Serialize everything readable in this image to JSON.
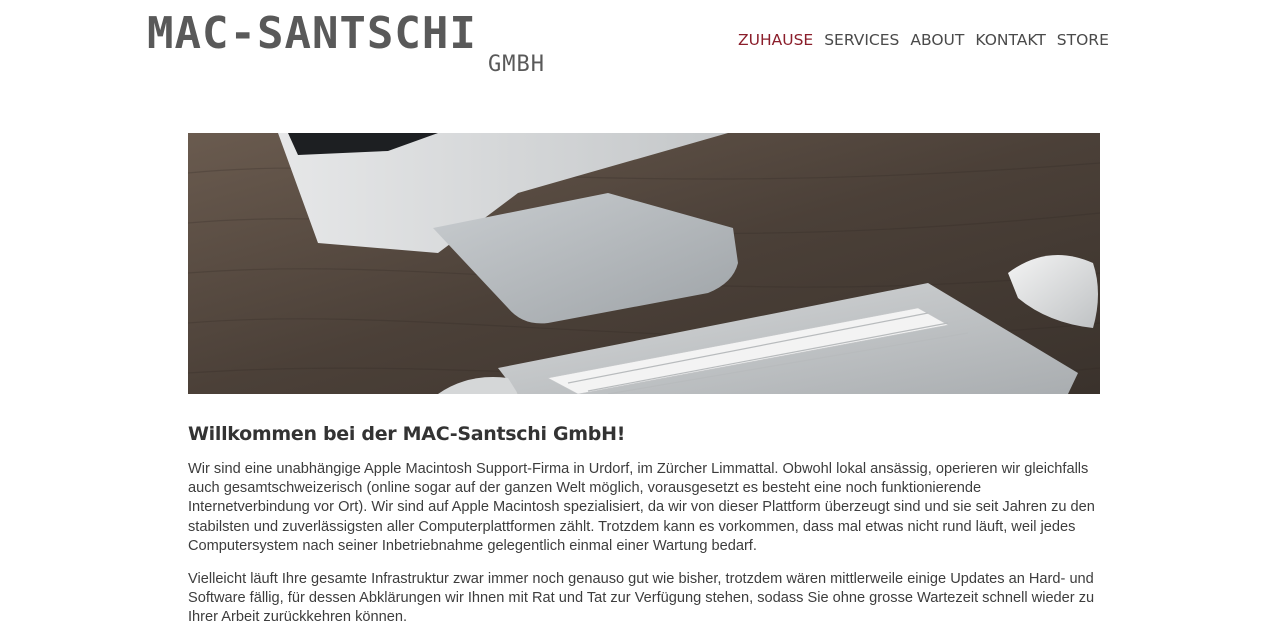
{
  "brand": {
    "name": "MAC-SANTSCHI",
    "suffix": "GMBH"
  },
  "nav": {
    "items": [
      {
        "label": "ZUHAUSE",
        "active": true
      },
      {
        "label": "SERVICES",
        "active": false
      },
      {
        "label": "ABOUT",
        "active": false
      },
      {
        "label": "KONTAKT",
        "active": false
      },
      {
        "label": "STORE",
        "active": false
      }
    ]
  },
  "colors": {
    "accent": "#8b1e2b",
    "text": "#3d3d3d",
    "logo": "#595959"
  },
  "hero": {
    "image": "imac-keyboard-mouse-on-wooden-desk"
  },
  "main": {
    "heading": "Willkommen bei der MAC-Santschi GmbH!",
    "paragraphs": [
      "Wir sind eine unabhängige Apple Macintosh Support-Firma in Urdorf, im Zürcher Limmattal. Obwohl lokal ansässig, operieren wir gleichfalls auch gesamtschweizerisch (online sogar auf der ganzen Welt möglich, vorausgesetzt es besteht eine noch funktionierende Internetverbindung vor Ort). Wir sind auf Apple Macintosh spezialisiert, da wir von dieser Plattform überzeugt sind und sie seit Jahren zu den stabilsten und zuverlässigsten aller Computerplattformen zählt. Trotzdem kann es vorkommen, dass mal etwas nicht rund läuft, weil jedes Computersystem nach seiner Inbetriebnahme gelegentlich einmal einer Wartung bedarf.",
      "Vielleicht läuft Ihre gesamte Infrastruktur zwar immer noch genauso gut wie bisher, trotzdem wären mittlerweile einige Updates an Hard- und Software fällig, für dessen Abklärungen wir Ihnen mit Rat und Tat zur Verfügung stehen, sodass Sie ohne grosse Wartezeit schnell wieder zu Ihrer Arbeit zurückkehren können."
    ]
  }
}
